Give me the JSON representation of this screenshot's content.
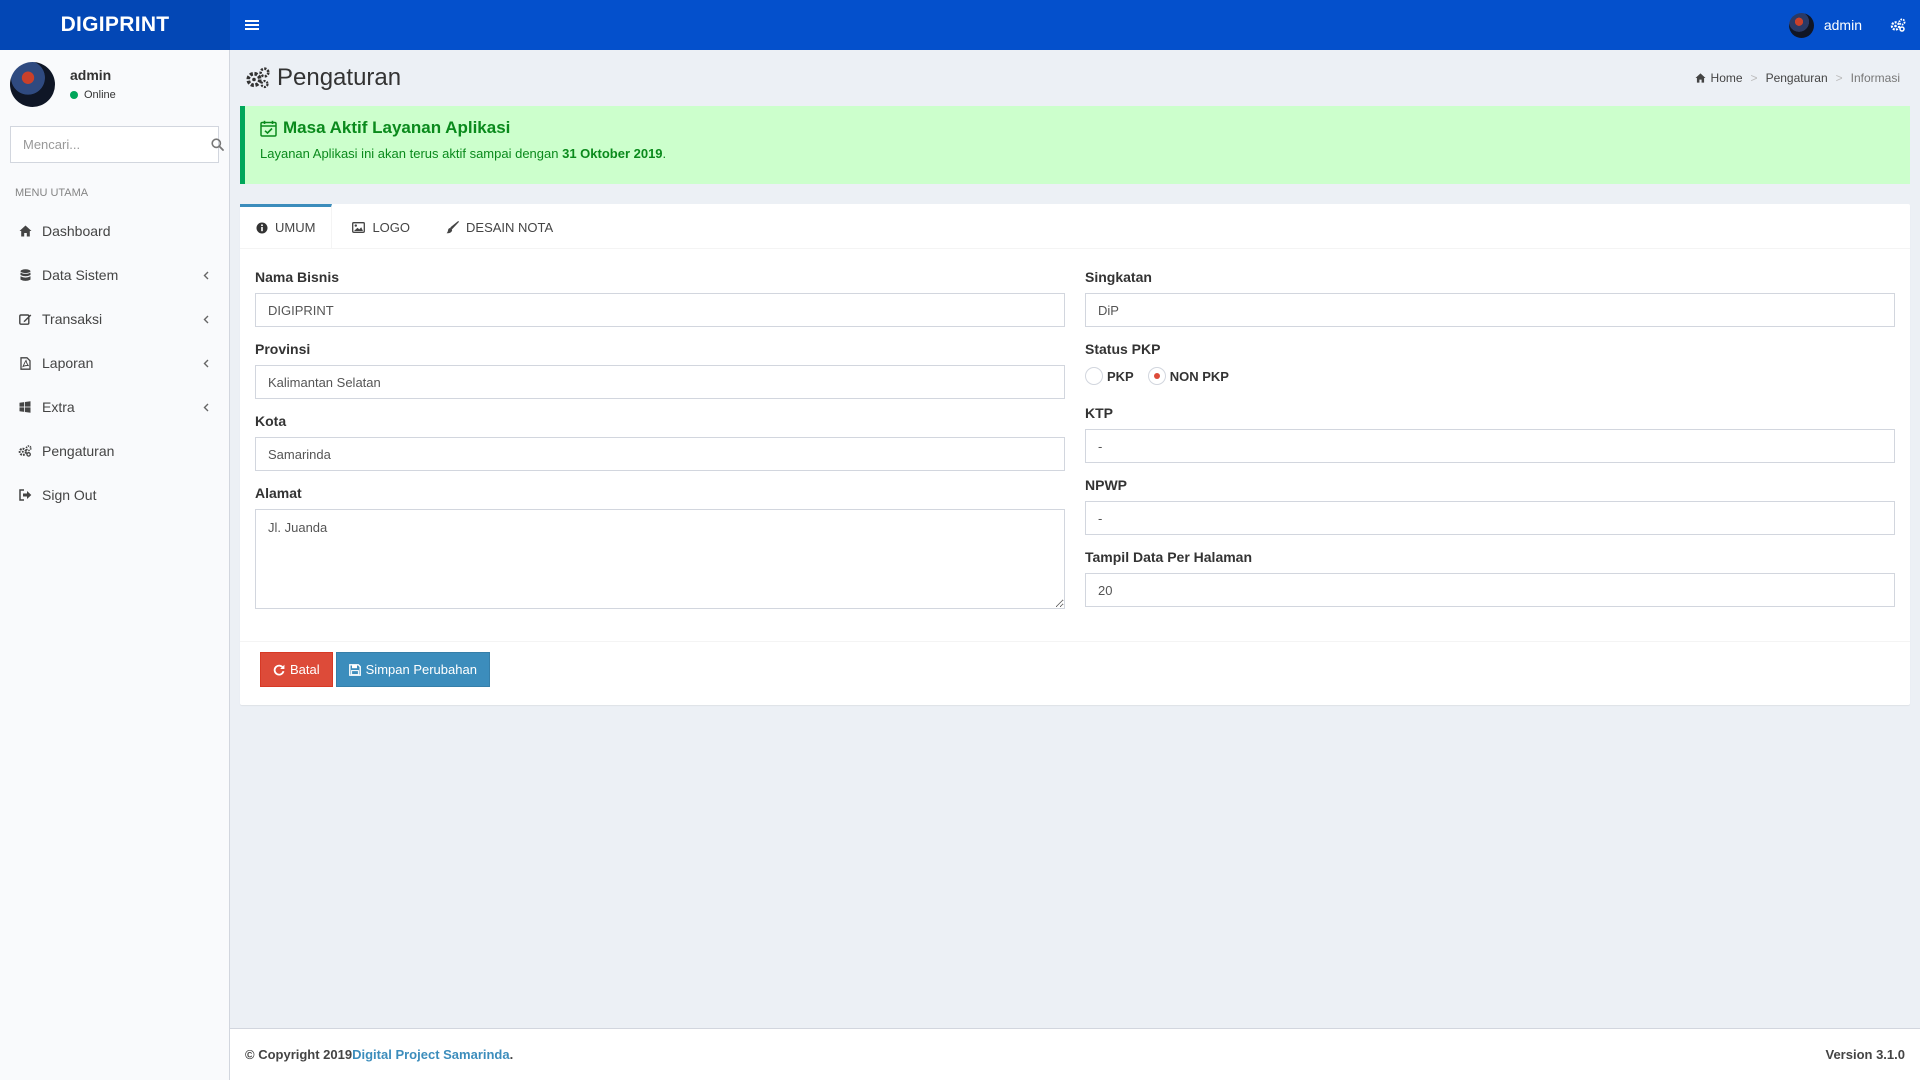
{
  "brand": "DIGIPRINT",
  "colors": {
    "topbar": "#0450cc",
    "accent": "#3c8dbc",
    "danger": "#dd4b39",
    "success_bg": "#ccffcc",
    "success_text": "#0a8a1c"
  },
  "header": {
    "user_name": "admin",
    "icons": [
      "bars-icon",
      "user-avatar",
      "gears-icon"
    ]
  },
  "sidebar": {
    "user": {
      "name": "admin",
      "status": "Online"
    },
    "search": {
      "placeholder": "Mencari..."
    },
    "menu_header": "MENU UTAMA",
    "items": [
      {
        "label": "Dashboard",
        "icon": "home-icon",
        "has_children": false
      },
      {
        "label": "Data Sistem",
        "icon": "database-icon",
        "has_children": true
      },
      {
        "label": "Transaksi",
        "icon": "edit-icon",
        "has_children": true
      },
      {
        "label": "Laporan",
        "icon": "file-pdf-icon",
        "has_children": true
      },
      {
        "label": "Extra",
        "icon": "windows-icon",
        "has_children": true
      },
      {
        "label": "Pengaturan",
        "icon": "gears-icon",
        "has_children": false
      },
      {
        "label": "Sign Out",
        "icon": "sign-out-icon",
        "has_children": false
      }
    ]
  },
  "page": {
    "title": "Pengaturan",
    "breadcrumb": [
      "Home",
      "Pengaturan",
      "Informasi"
    ]
  },
  "alert": {
    "title": "Masa Aktif Layanan Aplikasi",
    "text_prefix": "Layanan Aplikasi ini akan terus aktif sampai dengan ",
    "date": "31 Oktober 2019",
    "text_suffix": "."
  },
  "tabs": [
    {
      "label": "UMUM",
      "icon": "info-circle-icon",
      "active": true
    },
    {
      "label": "LOGO",
      "icon": "image-icon",
      "active": false
    },
    {
      "label": "DESAIN NOTA",
      "icon": "paint-brush-icon",
      "active": false
    }
  ],
  "form": {
    "nama_bisnis": {
      "label": "Nama Bisnis",
      "value": "DIGIPRINT"
    },
    "provinsi": {
      "label": "Provinsi",
      "value": "Kalimantan Selatan"
    },
    "kota": {
      "label": "Kota",
      "value": "Samarinda"
    },
    "alamat": {
      "label": "Alamat",
      "value": "Jl. Juanda"
    },
    "singkatan": {
      "label": "Singkatan",
      "value": "DiP"
    },
    "status_pkp": {
      "label": "Status PKP",
      "options": [
        "PKP",
        "NON PKP"
      ],
      "selected": "NON PKP"
    },
    "ktp": {
      "label": "KTP",
      "value": "-"
    },
    "npwp": {
      "label": "NPWP",
      "value": "-"
    },
    "per_halaman": {
      "label": "Tampil Data Per Halaman",
      "value": "20"
    }
  },
  "buttons": {
    "cancel": "Batal",
    "save": "Simpan Perubahan"
  },
  "footer": {
    "copyright_prefix": "© Copyright 2019 ",
    "company": "Digital Project Samarinda",
    "suffix": ".",
    "version": "Version 3.1.0"
  }
}
